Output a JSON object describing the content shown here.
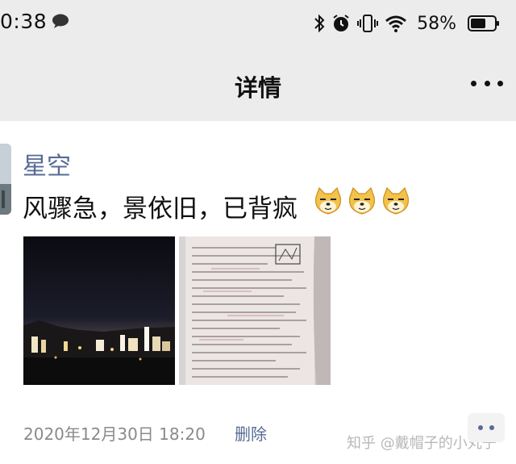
{
  "status_bar": {
    "time": "0:38",
    "battery_percent": "58%",
    "icons": [
      "chat-bubble-icon",
      "bluetooth-icon",
      "alarm-icon",
      "vibrate-icon",
      "wifi-icon",
      "battery-icon"
    ]
  },
  "nav": {
    "title": "详情",
    "more_icon": "more-dots-icon"
  },
  "post": {
    "author": "星空",
    "text": "风骤急，景依旧，已背疯",
    "emoji": [
      "doge-emoji",
      "doge-emoji",
      "doge-emoji"
    ],
    "photos": [
      "night-city-photo",
      "handwritten-notes-photo"
    ],
    "timestamp": "2020年12月30日 18:20",
    "delete_label": "删除"
  },
  "watermark": "知乎 @戴帽子的小丸子",
  "colors": {
    "link": "#576b95",
    "header_bg": "#ececec",
    "timestamp": "#8a8a8a"
  }
}
